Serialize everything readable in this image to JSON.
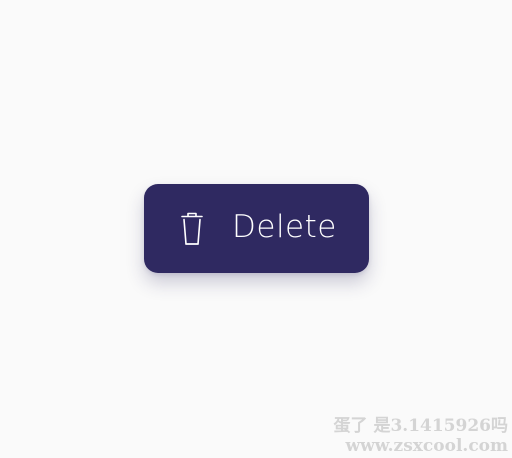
{
  "delete_button": {
    "label": "Delete",
    "icon": "trash-icon",
    "background_color": "#2f2961",
    "text_color": "#ffffff"
  },
  "watermark": {
    "line1": "蛋了 是3.1415926吗",
    "line2": "www.zsxcool.com"
  },
  "page": {
    "background_color": "#fafafa"
  }
}
